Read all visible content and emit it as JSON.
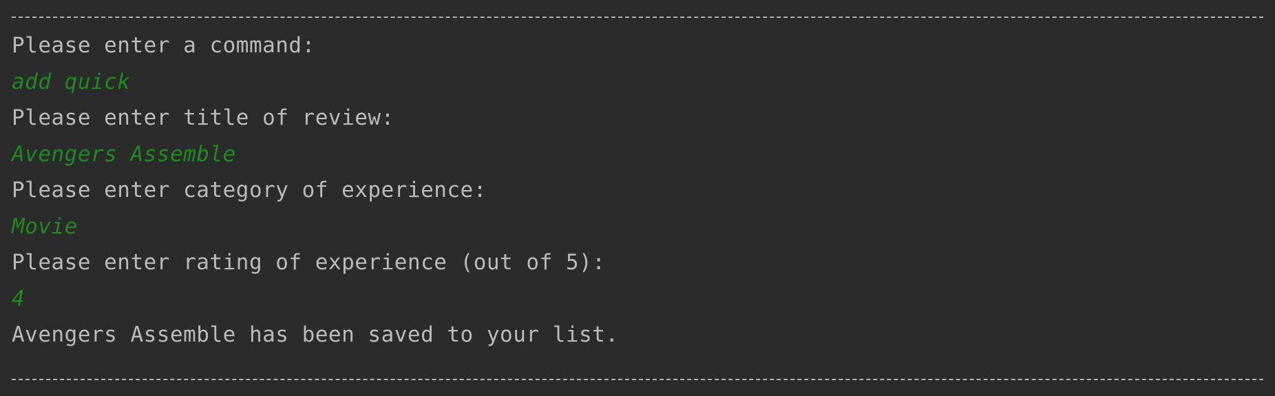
{
  "console": {
    "separator_top": "--------------------------------------------------------------------------------------------",
    "separator_bottom": "--------------------------------------------------------------------------------------------",
    "lines": [
      {
        "kind": "output",
        "text": "Please enter a command:"
      },
      {
        "kind": "input",
        "text": "add quick"
      },
      {
        "kind": "output",
        "text": "Please enter title of review:"
      },
      {
        "kind": "input",
        "text": "Avengers Assemble"
      },
      {
        "kind": "output",
        "text": "Please enter category of experience:"
      },
      {
        "kind": "input",
        "text": "Movie"
      },
      {
        "kind": "output",
        "text": "Please enter rating of experience (out of 5):"
      },
      {
        "kind": "input",
        "text": "4"
      },
      {
        "kind": "output",
        "text": "Avengers Assemble has been saved to your list."
      }
    ]
  },
  "colors": {
    "background": "#2b2b2b",
    "output_text": "#bbbbbb",
    "user_input_text": "#1f8a1f",
    "separator": "#b3b3b3"
  }
}
